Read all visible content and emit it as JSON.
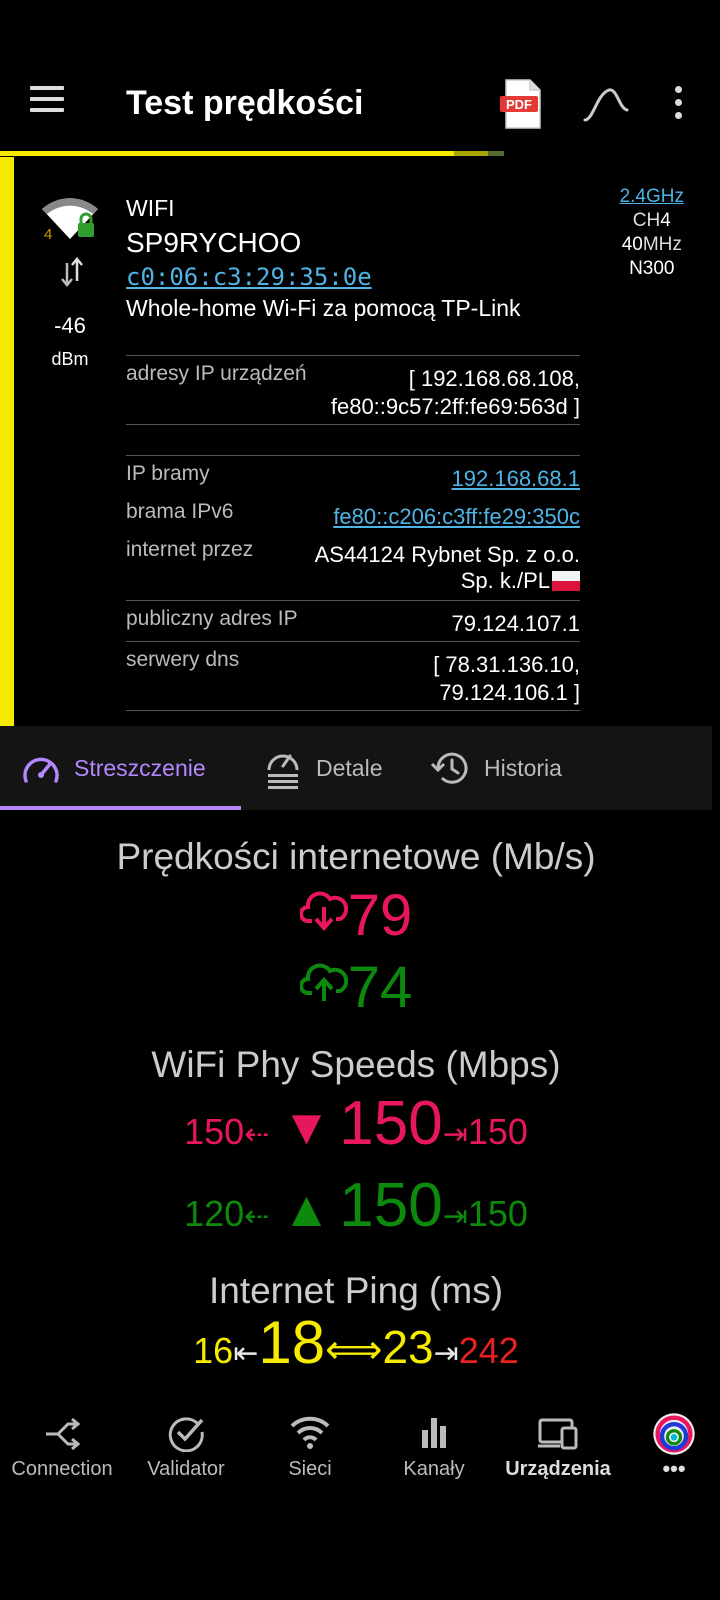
{
  "appbar": {
    "title": "Test prędkości",
    "pdf_label": "PDF",
    "icons": [
      "menu-icon",
      "pdf-icon",
      "wave-icon",
      "more-vert-icon"
    ]
  },
  "progress": {
    "fraction": 0.7
  },
  "network": {
    "wifi_generation": "4",
    "signal_dbm": "-46",
    "signal_unit": "dBm",
    "type": "WIFI",
    "ssid": "SP9RYCHOO",
    "bssid": "c0:06:c3:29:35:0e",
    "vendor": "Whole-home Wi-Fi za pomocą TP-Link",
    "band": "2.4GHz",
    "channel_label": "CH",
    "channel": "4",
    "width_num": "40",
    "width_unit": "MHz",
    "standard": "N300"
  },
  "rows": {
    "device_ip_label": "adresy IP urządzeń",
    "device_ip_line1": "[ 192.168.68.108,",
    "device_ip_line2": "fe80::9c57:2ff:fe69:563d ]",
    "gateway_label": "IP bramy",
    "gateway_value": "192.168.68.1",
    "gateway6_label": "brama IPv6",
    "gateway6_value": "fe80::c206:c3ff:fe29:350c",
    "isp_label": "internet przez",
    "isp_line1": "AS44124 Rybnet Sp. z o.o.",
    "isp_line2": "Sp. k./PL",
    "public_ip_label": "publiczny adres IP",
    "public_ip_value": "79.124.107.1",
    "dns_label": "serwery dns",
    "dns_line1": "[ 78.31.136.10,",
    "dns_line2": "79.124.106.1 ]"
  },
  "tabs": [
    {
      "label": "Streszczenie",
      "active": true
    },
    {
      "label": "Detale",
      "active": false
    },
    {
      "label": "Historia",
      "active": false
    }
  ],
  "speeds": {
    "internet_heading": "Prędkości internetowe (Mb/s)",
    "download": "79",
    "upload": "74",
    "phy_heading": "WiFi Phy Speeds (Mbps)",
    "phy_down_min": "150",
    "phy_down_cur": "150",
    "phy_down_max": "150",
    "phy_up_min": "120",
    "phy_up_cur": "150",
    "phy_up_max": "150",
    "ping_heading": "Internet Ping (ms)",
    "ping_min": "16",
    "ping_cur": "18",
    "ping_avg": "23",
    "ping_max": "242"
  },
  "bottomnav": [
    {
      "label": "Connection",
      "icon": "connection-icon"
    },
    {
      "label": "Validator",
      "icon": "check-circle-icon"
    },
    {
      "label": "Sieci",
      "icon": "wifi-icon"
    },
    {
      "label": "Kanały",
      "icon": "bar-chart-icon"
    },
    {
      "label": "Urządzenia",
      "icon": "devices-icon",
      "active": true
    },
    {
      "label": "•••",
      "icon": "app-logo-icon"
    }
  ],
  "colors": {
    "accent": "#b388ff",
    "download": "#e8175d",
    "upload": "#0d8a0d",
    "ping": "#f5ea00",
    "ping_max": "#e82020",
    "link": "#4fb3e6",
    "signal_bar": "#f5ea00"
  }
}
